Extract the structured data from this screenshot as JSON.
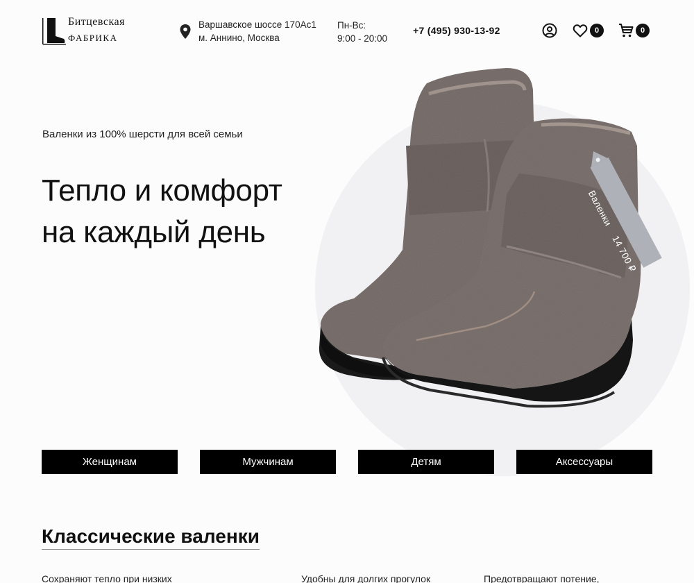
{
  "header": {
    "logo": {
      "line1": "Битцевская",
      "line2": "ФАБРИКА"
    },
    "address": {
      "line1": "Варшавское шоссе 170Ас1",
      "line2": "м. Аннино, Москва"
    },
    "hours": {
      "line1": "Пн-Вс:",
      "line2": "9:00 - 20:00"
    },
    "phone": "+7 (495) 930-13-92",
    "favorites_count": "0",
    "cart_count": "0"
  },
  "hero": {
    "subtitle": "Валенки из 100% шерсти для всей семьи",
    "title_line1": "Тепло и комфорт",
    "title_line2": "на каждый день",
    "tag_name": "Валенки",
    "tag_price": "14 700 ₽"
  },
  "categories": [
    "Женщинам",
    "Мужчинам",
    "Детям",
    "Аксессуары"
  ],
  "section": {
    "title": "Классические валенки",
    "features": [
      "Сохраняют тепло при низких",
      "Удобны для долгих прогулок",
      "Предотвращают потение,"
    ]
  },
  "colors": {
    "accent": "#000000",
    "hero_bg": "#f1f1f3",
    "felt": "#7a706c",
    "sole": "#1a1a1a"
  }
}
